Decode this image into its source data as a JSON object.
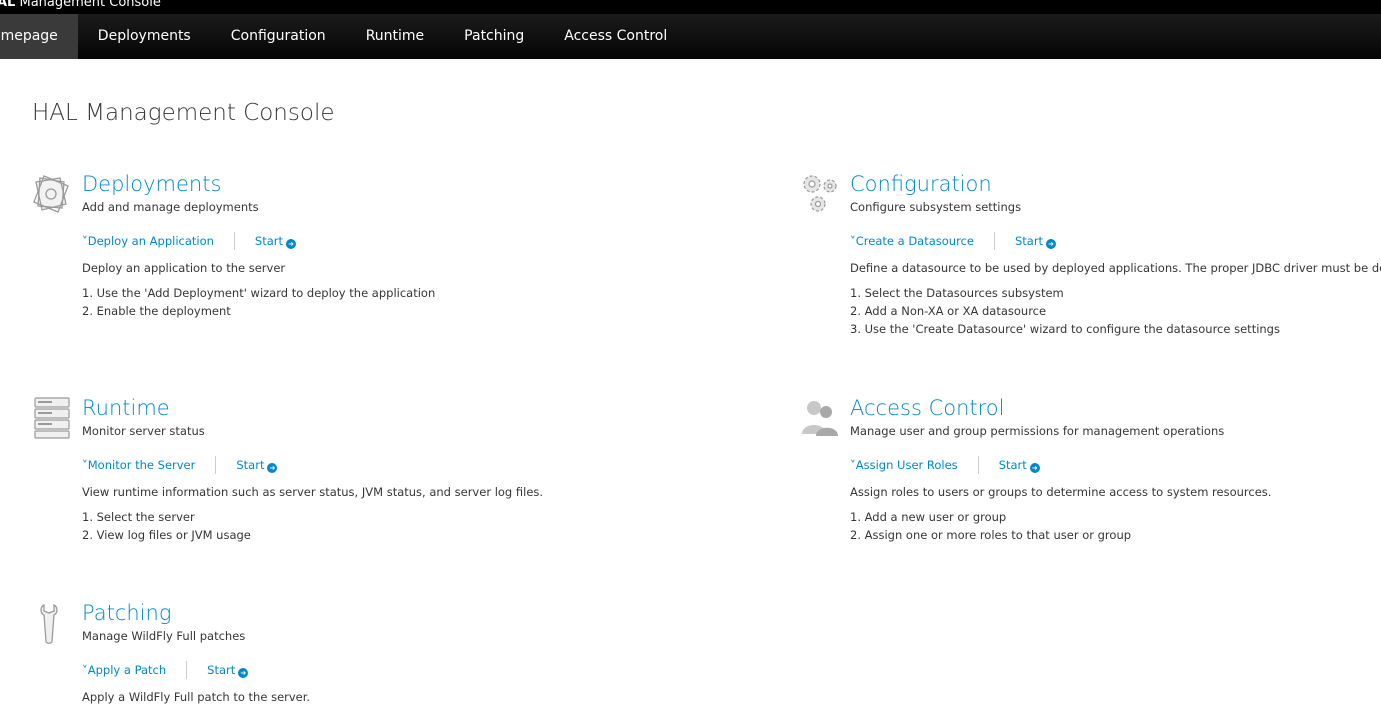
{
  "app": {
    "brand_bold": "AL",
    "brand_rest": " Management Console"
  },
  "nav": {
    "items": [
      "omepage",
      "Deployments",
      "Configuration",
      "Runtime",
      "Patching",
      "Access Control"
    ],
    "active": 0
  },
  "page": {
    "title": "HAL Management Console"
  },
  "modules": [
    {
      "key": "deployments",
      "title": "Deployments",
      "subtitle": "Add and manage deployments",
      "task": "Deploy an Application",
      "start": "Start",
      "description": "Deploy an application to the server",
      "steps": [
        "1. Use the 'Add Deployment' wizard to deploy the application",
        "2. Enable the deployment"
      ],
      "icon": "deployments-icon"
    },
    {
      "key": "configuration",
      "title": "Configuration",
      "subtitle": "Configure subsystem settings",
      "task": "Create a Datasource",
      "start": "Start",
      "description": "Define a datasource to be used by deployed applications. The proper JDBC driver must be deplo",
      "steps": [
        "1. Select the Datasources subsystem",
        "2. Add a Non-XA or XA datasource",
        "3. Use the 'Create Datasource' wizard to configure the datasource settings"
      ],
      "icon": "gears-icon"
    },
    {
      "key": "runtime",
      "title": "Runtime",
      "subtitle": "Monitor server status",
      "task": "Monitor the Server",
      "start": "Start",
      "description": "View runtime information such as server status, JVM status, and server log files.",
      "steps": [
        "1. Select the server",
        "2. View log files or JVM usage"
      ],
      "icon": "server-icon"
    },
    {
      "key": "access-control",
      "title": "Access Control",
      "subtitle": "Manage user and group permissions for management operations",
      "task": "Assign User Roles",
      "start": "Start",
      "description": "Assign roles to users or groups to determine access to system resources.",
      "steps": [
        "1. Add a new user or group",
        "2. Assign one or more roles to that user or group"
      ],
      "icon": "users-icon"
    },
    {
      "key": "patching",
      "title": "Patching",
      "subtitle": "Manage WildFly Full patches",
      "task": "Apply a Patch",
      "start": "Start",
      "description": "Apply a WildFly Full patch to the server.",
      "steps": [],
      "icon": "wrench-icon"
    }
  ],
  "colors": {
    "link": "#0088ce",
    "navbar": "#0c0c0c",
    "active_nav": "#3a3a3a"
  }
}
